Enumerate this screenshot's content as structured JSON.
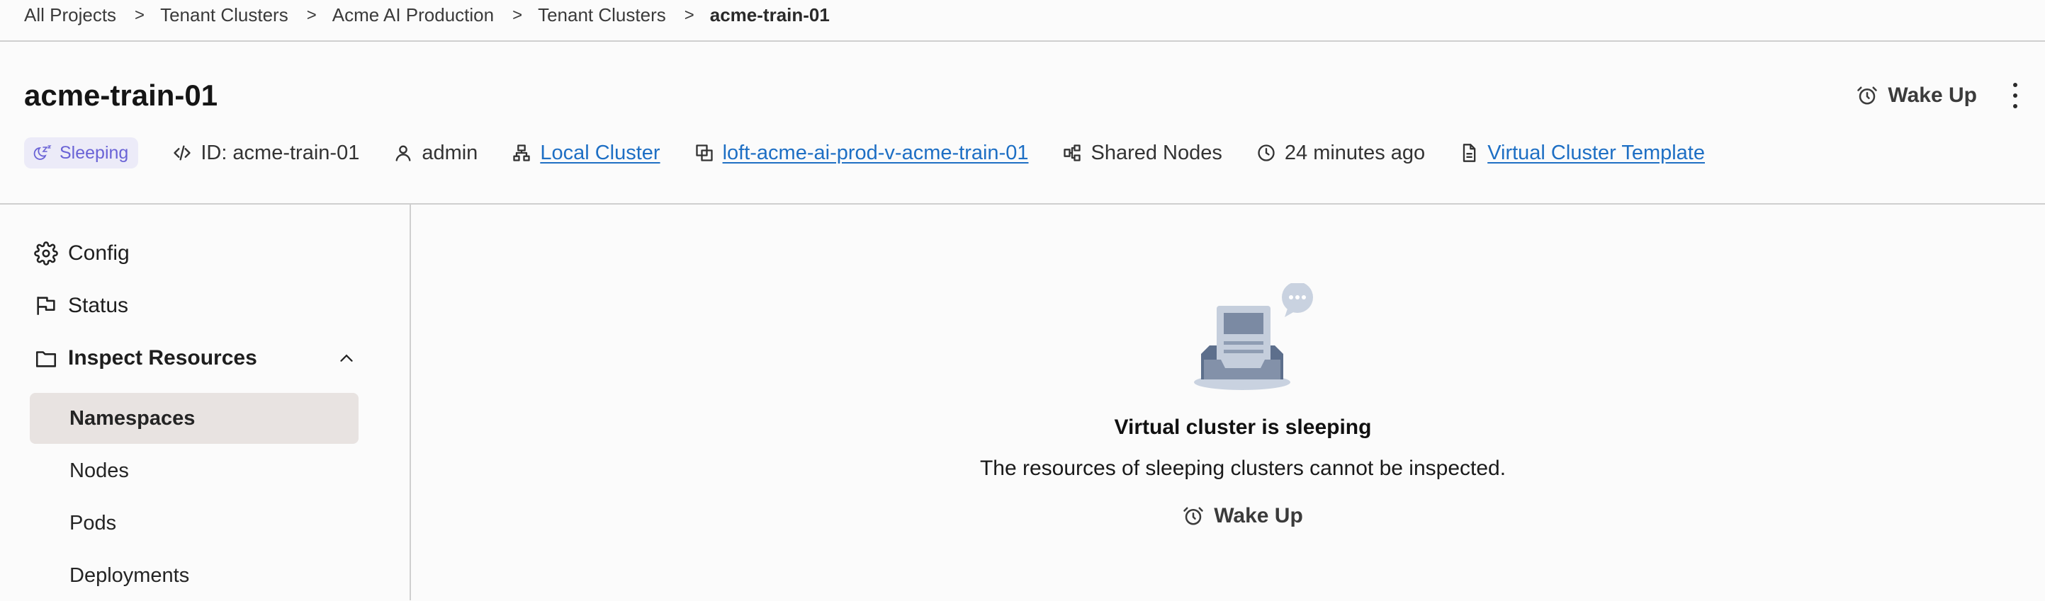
{
  "breadcrumb": {
    "items": [
      "All Projects",
      "Tenant Clusters",
      "Acme AI Production",
      "Tenant Clusters",
      "acme-train-01"
    ],
    "separator": ">"
  },
  "header": {
    "title": "acme-train-01",
    "wake_up_label": "Wake Up",
    "status_badge": "Sleeping",
    "id_label": "ID: acme-train-01",
    "owner": "admin",
    "cluster_link": "Local Cluster",
    "namespace_link": "loft-acme-ai-prod-v-acme-train-01",
    "nodes_mode": "Shared Nodes",
    "created_ago": "24 minutes ago",
    "template_link": "Virtual Cluster Template"
  },
  "sidebar": {
    "config": "Config",
    "status": "Status",
    "inspect": "Inspect Resources",
    "sub_items": [
      "Namespaces",
      "Nodes",
      "Pods",
      "Deployments"
    ],
    "active": "Namespaces"
  },
  "empty_state": {
    "title": "Virtual cluster is sleeping",
    "description": "The resources of sleeping clusters cannot be inspected.",
    "action_label": "Wake Up"
  },
  "colors": {
    "accent_link": "#1e6fc4",
    "badge_text": "#6a63d6",
    "badge_bg": "#ecebf8",
    "active_bg": "#e8e3e1"
  },
  "icons": {
    "wake": "alarm-clock-icon",
    "more": "kebab-menu-icon",
    "sleeping": "sleep-zzz-icon",
    "id": "code-icon",
    "owner": "user-icon",
    "cluster": "sitemap-icon",
    "namespace": "copy-icon",
    "nodes": "shared-nodes-icon",
    "time": "clock-icon",
    "template": "document-icon",
    "config": "gear-icon",
    "status": "flag-icon",
    "inspect": "folder-icon",
    "collapse": "chevron-up-icon"
  }
}
